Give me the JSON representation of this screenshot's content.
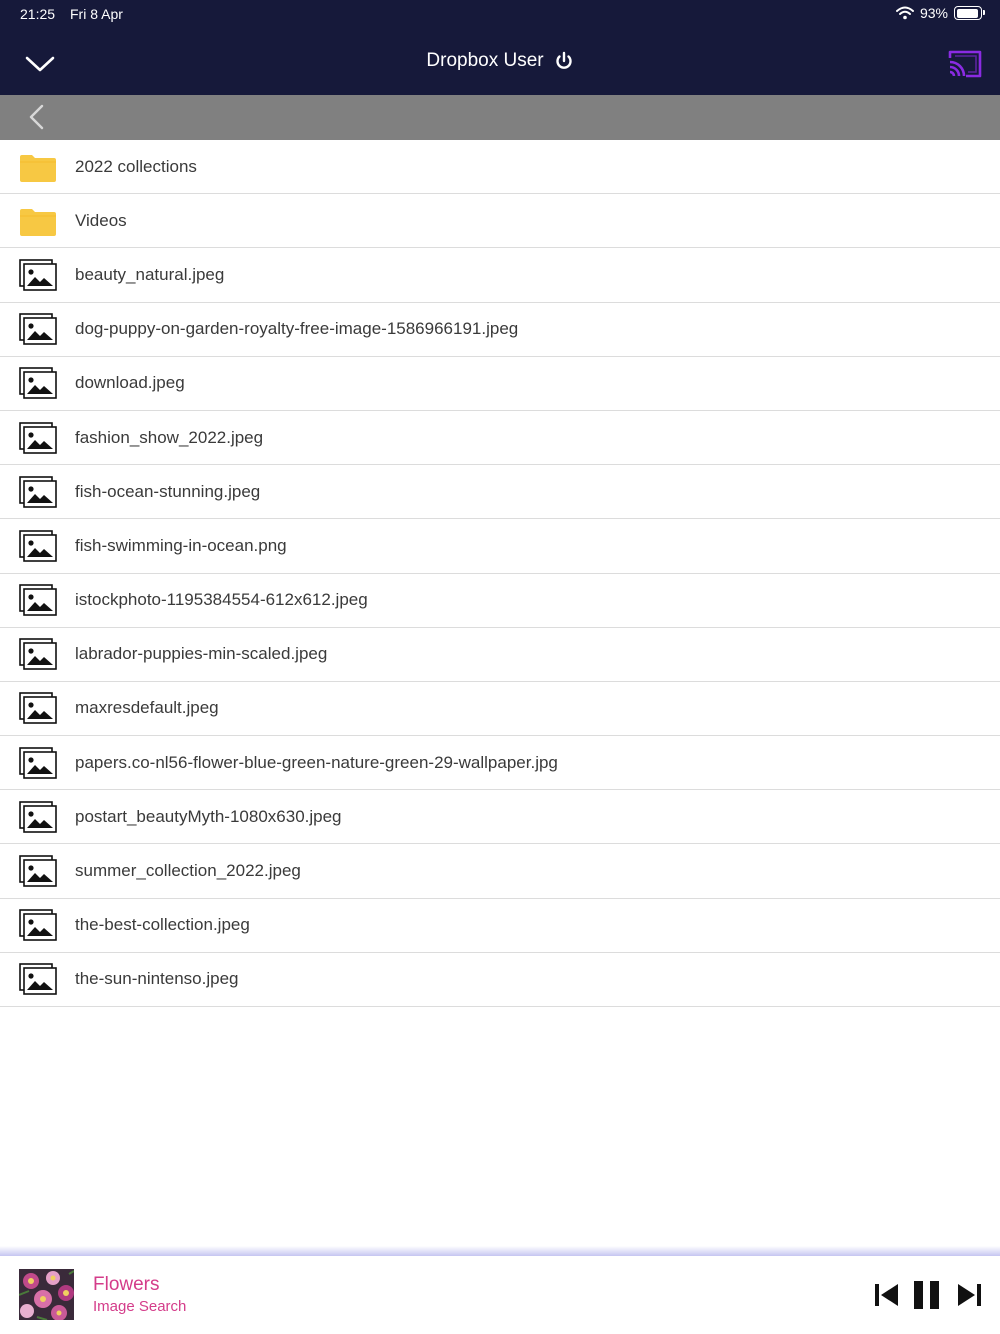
{
  "status_bar": {
    "time": "21:25",
    "date": "Fri 8 Apr",
    "battery": "93%",
    "battery_level": 0.93
  },
  "header": {
    "title": "Dropbox User"
  },
  "colors": {
    "header_bg": "#16193a",
    "subbar_bg": "#808080",
    "folder": "#f7c843",
    "cast_accent": "#8a2be2",
    "player_text": "#d43c8a"
  },
  "files": [
    {
      "name": "2022 collections",
      "type": "folder",
      "icon": "folder-icon"
    },
    {
      "name": "Videos",
      "type": "folder",
      "icon": "folder-icon"
    },
    {
      "name": "beauty_natural.jpeg",
      "type": "image",
      "icon": "image-icon"
    },
    {
      "name": "dog-puppy-on-garden-royalty-free-image-1586966191.jpeg",
      "type": "image",
      "icon": "image-icon"
    },
    {
      "name": "download.jpeg",
      "type": "image",
      "icon": "image-icon"
    },
    {
      "name": "fashion_show_2022.jpeg",
      "type": "image",
      "icon": "image-icon"
    },
    {
      "name": "fish-ocean-stunning.jpeg",
      "type": "image",
      "icon": "image-icon"
    },
    {
      "name": "fish-swimming-in-ocean.png",
      "type": "image",
      "icon": "image-icon"
    },
    {
      "name": "istockphoto-1195384554-612x612.jpeg",
      "type": "image",
      "icon": "image-icon"
    },
    {
      "name": "labrador-puppies-min-scaled.jpeg",
      "type": "image",
      "icon": "image-icon"
    },
    {
      "name": "maxresdefault.jpeg",
      "type": "image",
      "icon": "image-icon"
    },
    {
      "name": "papers.co-nl56-flower-blue-green-nature-green-29-wallpaper.jpg",
      "type": "image",
      "icon": "image-icon"
    },
    {
      "name": "postart_beautyMyth-1080x630.jpeg",
      "type": "image",
      "icon": "image-icon"
    },
    {
      "name": "summer_collection_2022.jpeg",
      "type": "image",
      "icon": "image-icon"
    },
    {
      "name": "the-best-collection.jpeg",
      "type": "image",
      "icon": "image-icon"
    },
    {
      "name": "the-sun-nintenso.jpeg",
      "type": "image",
      "icon": "image-icon"
    }
  ],
  "player": {
    "title": "Flowers",
    "subtitle": "Image Search"
  }
}
